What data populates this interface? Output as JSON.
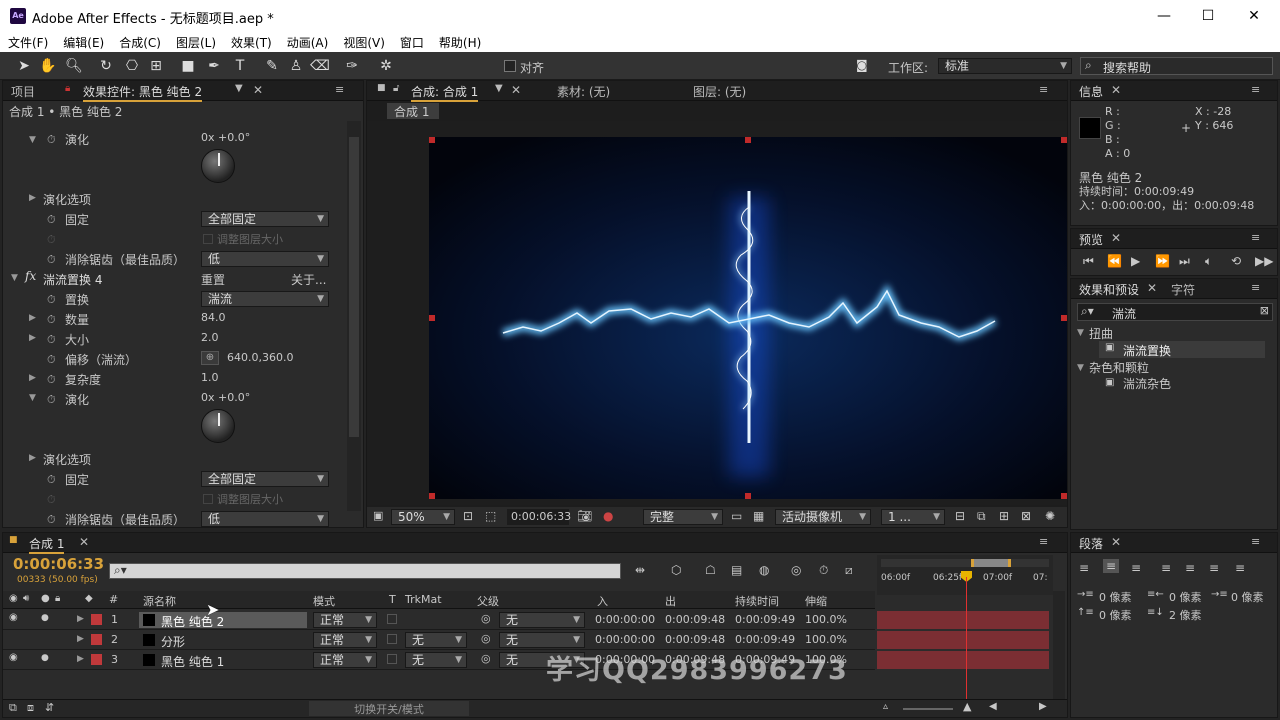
{
  "app": {
    "title": "Adobe After Effects - 无标题项目.aep *",
    "logo": "Ae",
    "min": "—",
    "max": "☐",
    "close": "✕"
  },
  "menu": [
    "文件(F)",
    "编辑(E)",
    "合成(C)",
    "图层(L)",
    "效果(T)",
    "动画(A)",
    "视图(V)",
    "窗口",
    "帮助(H)"
  ],
  "toolbar": {
    "align_label": "对齐",
    "workspace_label": "工作区:",
    "workspace_value": "标准",
    "help_placeholder": "搜索帮助"
  },
  "left_panel": {
    "tab_project": "项目",
    "tab_effects": "效果控件: 黑色 纯色 2",
    "breadcrumb": "合成 1 • 黑色 纯色 2",
    "props": [
      {
        "label": "演化",
        "value": "0x +0.0°"
      },
      {
        "label": "演化选项"
      },
      {
        "label": "固定",
        "value": "全部固定"
      },
      {
        "label": "调整图层大小"
      },
      {
        "label": "消除锯齿（最佳品质）",
        "value": "低"
      },
      {
        "label": "湍流置换 4",
        "reset": "重置",
        "about": "关于..."
      },
      {
        "label": "置换",
        "value": "湍流"
      },
      {
        "label": "数量",
        "value": "84.0"
      },
      {
        "label": "大小",
        "value": "2.0"
      },
      {
        "label": "偏移（湍流）",
        "value": "640.0,360.0"
      },
      {
        "label": "复杂度",
        "value": "1.0"
      },
      {
        "label": "演化",
        "value": "0x +0.0°"
      },
      {
        "label": "演化选项"
      },
      {
        "label": "固定",
        "value": "全部固定"
      },
      {
        "label": "调整图层大小"
      },
      {
        "label": "消除锯齿（最佳品质）",
        "value": "低"
      }
    ]
  },
  "composition": {
    "tab": "合成: 合成 1",
    "footage": "素材: (无)",
    "layer": "图层: (无)",
    "subtab": "合成 1",
    "zoom": "50%",
    "time": "0:00:06:33",
    "quality": "完整",
    "camera": "活动摄像机",
    "views": "1 ..."
  },
  "info": {
    "tab": "信息",
    "r": "R :",
    "g": "G :",
    "b": "B :",
    "a": "A : 0",
    "x": "X : -28",
    "y": "Y : 646",
    "name": "黑色 纯色 2",
    "duration": "持续时间：0:00:09:49",
    "inout": "入：0:00:00:00，出：0:00:09:48"
  },
  "preview": {
    "tab": "预览"
  },
  "effects_presets": {
    "tab": "效果和预设",
    "tab2": "字符",
    "search": "湍流",
    "items": [
      {
        "label": "扭曲",
        "group": true
      },
      {
        "label": "湍流置换",
        "group": false
      },
      {
        "label": "杂色和颗粒",
        "group": true
      },
      {
        "label": "湍流杂色",
        "group": false
      }
    ]
  },
  "paragraph": {
    "tab": "段落",
    "fields": [
      "0 像素",
      "0 像素",
      "0 像素",
      "0 像素",
      "2 像素"
    ]
  },
  "timeline": {
    "tab": "合成 1",
    "time": "0:00:06:33",
    "fps": "00333 (50.00 fps)",
    "headers": {
      "num": "#",
      "name": "源名称",
      "mode": "模式",
      "t": "T",
      "trkmat": "TrkMat",
      "parent": "父级",
      "in": "入",
      "out": "出",
      "dur": "持续时间",
      "stretch": "伸缩"
    },
    "layers": [
      {
        "num": "1",
        "name": "黑色 纯色 2",
        "mode": "正常",
        "trkmat": "",
        "parent": "无",
        "in": "0:00:00:00",
        "out": "0:00:09:48",
        "dur": "0:00:09:49",
        "stretch": "100.0%"
      },
      {
        "num": "2",
        "name": "分形",
        "mode": "正常",
        "trkmat": "无",
        "parent": "无",
        "in": "0:00:00:00",
        "out": "0:00:09:48",
        "dur": "0:00:09:49",
        "stretch": "100.0%"
      },
      {
        "num": "3",
        "name": "黑色 纯色 1",
        "mode": "正常",
        "trkmat": "无",
        "parent": "无",
        "in": "0:00:00:00",
        "out": "0:00:09:48",
        "dur": "0:00:09:49",
        "stretch": "100.0%"
      }
    ],
    "ruler": [
      "06:00f",
      "06:25f",
      "07:00f",
      "07:"
    ],
    "toggle_label": "切换开关/模式"
  },
  "watermark": "学习QQ2983996273",
  "colors": {
    "accent": "#d8a23a",
    "layer_red": "#c0393b",
    "bar": "#7b2e33",
    "glow": "#62b8ff"
  }
}
